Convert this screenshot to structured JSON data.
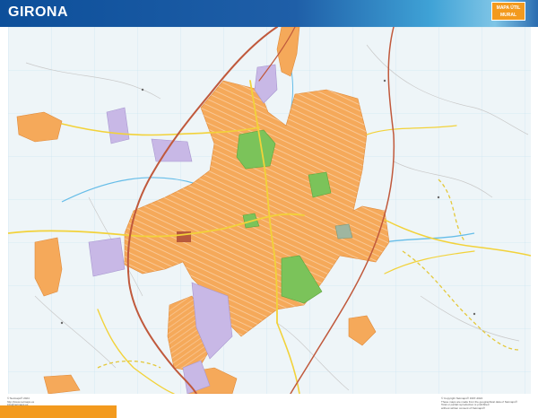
{
  "header": {
    "title": "GIRONA",
    "badge": {
      "line1": "MAPA ÚTIL",
      "line2": "MURAL"
    }
  },
  "footer": {
    "left_lines": [
      "© Netmaps® 2024",
      "http://www.netmaps.es",
      "info@netmaps.es"
    ],
    "right_lines": [
      "© Copyright Netmaps® 1997-2024",
      "These maps are made from the geographical data of Netmaps®",
      "Total or partial reproduction is prohibited",
      "without written consent of Netmaps®"
    ]
  },
  "colors": {
    "header": "#1f5fa8",
    "badge": "#f39a1e",
    "urban": "#f5a95a",
    "industrial": "#c8b8e6",
    "park": "#7bc35a",
    "river": "#66bde8",
    "railway": "#c0593c",
    "grid": "#cfe6f2",
    "background": "#eef5f8"
  }
}
